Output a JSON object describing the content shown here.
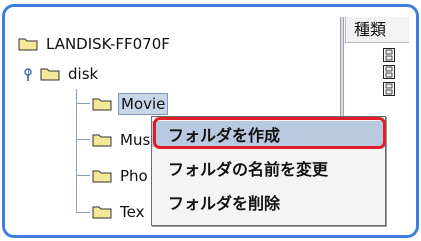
{
  "tree": {
    "root": {
      "label": "LANDISK-FF070F",
      "icon": "folder-icon"
    },
    "disk": {
      "label": "disk",
      "icon": "folder-icon",
      "expanded": true
    },
    "children": [
      {
        "label": "Movie",
        "selected": true
      },
      {
        "label": "Mus"
      },
      {
        "label": "Pho"
      },
      {
        "label": "Tex"
      }
    ]
  },
  "column": {
    "header": "種類",
    "icon": "film-icon"
  },
  "context_menu": {
    "items": [
      {
        "label": "フォルダを作成",
        "highlighted": true
      },
      {
        "label": "フォルダの名前を変更"
      },
      {
        "label": "フォルダを削除"
      }
    ]
  },
  "colors": {
    "frame": "#3c7fe0",
    "highlight_border": "#e21c28",
    "selection": "#c8d6ea"
  }
}
